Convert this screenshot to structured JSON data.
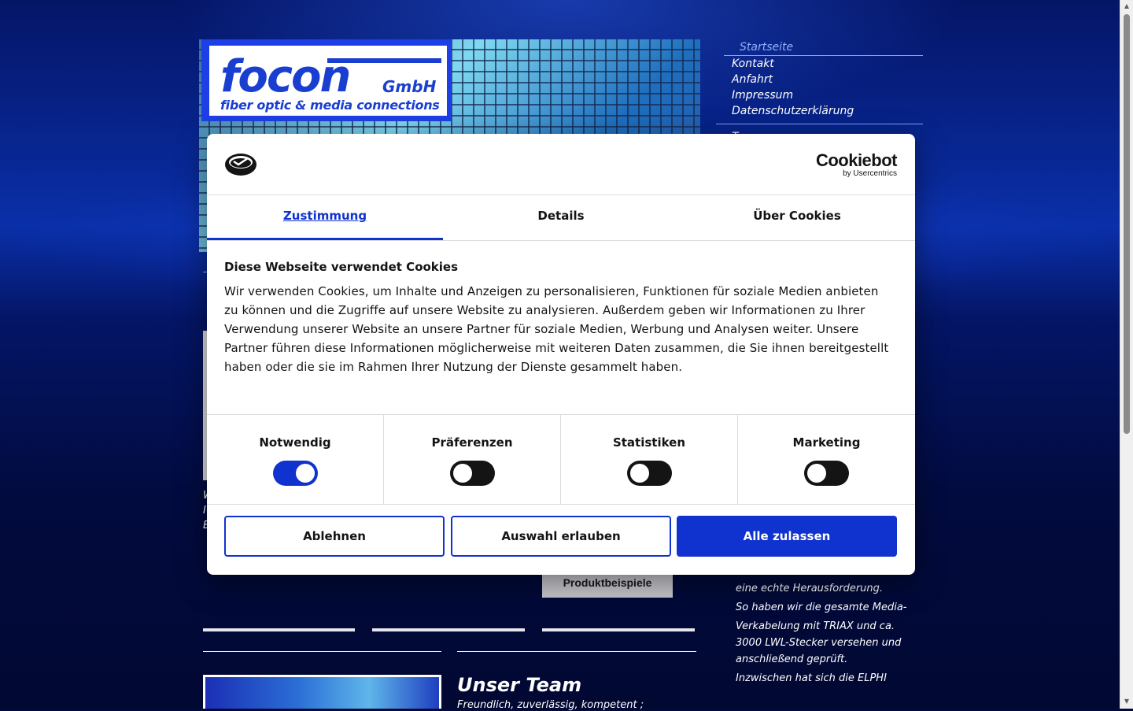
{
  "site": {
    "logo": {
      "word": "focon",
      "gmbh": "GmbH",
      "tagline": "fiber optic & media connections"
    },
    "nav": {
      "items": [
        {
          "label": "Startseite",
          "active": true
        },
        {
          "label": "Kontakt"
        },
        {
          "label": "Anfahrt"
        },
        {
          "label": "Impressum"
        },
        {
          "label": "Datenschutzerklärung"
        }
      ],
      "next_item": "Team"
    },
    "left_text": {
      "line1": "W",
      "line2": "I",
      "line3": "B"
    },
    "product_button": "Produktbeispiele",
    "team": {
      "title": "Unser Team",
      "subtitle": "Freundlich, zuverlässig, kompetent ;"
    },
    "right_text": [
      "eine echte Herausforderung.",
      "So haben wir die gesamte Media-",
      "Verkabelung mit TRIAX und ca. 3000 LWL-Stecker versehen und anschließend geprüft.",
      "Inzwischen hat sich die ELPHI"
    ]
  },
  "cookie_dialog": {
    "brand": {
      "name": "Cookiebot",
      "by": "by Usercentrics"
    },
    "tabs": [
      {
        "label": "Zustimmung",
        "active": true
      },
      {
        "label": "Details"
      },
      {
        "label": "Über Cookies"
      }
    ],
    "title": "Diese Webseite verwendet Cookies",
    "text": "Wir verwenden Cookies, um Inhalte und Anzeigen zu personalisieren, Funktionen für soziale Medien anbieten zu können und die Zugriffe auf unsere Website zu analysieren. Außerdem geben wir Informationen zu Ihrer Verwendung unserer Website an unsere Partner für soziale Medien, Werbung und Analysen weiter. Unsere Partner führen diese Informationen möglicherweise mit weiteren Daten zusammen, die Sie ihnen bereitgestellt haben oder die sie im Rahmen Ihrer Nutzung der Dienste gesammelt haben.",
    "toggles": [
      {
        "label": "Notwendig",
        "on": true
      },
      {
        "label": "Präferenzen",
        "on": false
      },
      {
        "label": "Statistiken",
        "on": false
      },
      {
        "label": "Marketing",
        "on": false
      }
    ],
    "buttons": {
      "decline": "Ablehnen",
      "allow_selection": "Auswahl erlauben",
      "allow_all": "Alle zulassen"
    },
    "colors": {
      "accent": "#1032cf"
    }
  }
}
